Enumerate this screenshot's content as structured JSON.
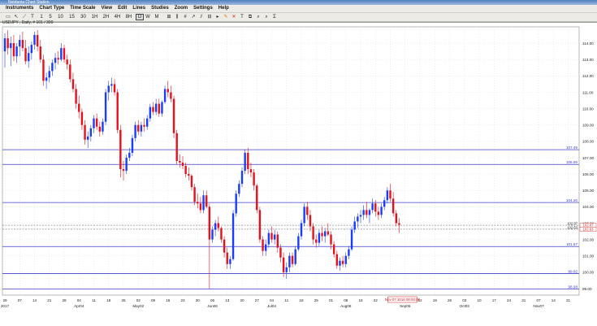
{
  "window": {
    "title": "Netdania Chart Station"
  },
  "menu": [
    "Instruments",
    "Chart Type",
    "Time Scale",
    "View",
    "Edit",
    "Lines",
    "Studies",
    "Zoom",
    "Settings",
    "Help"
  ],
  "toolbar": {
    "timeframes": [
      "T",
      "1",
      "5",
      "10",
      "15",
      "30",
      "1H",
      "2H",
      "4H",
      "8H",
      "D",
      "W",
      "M"
    ],
    "selected": "D"
  },
  "symbol_label": "USDJPY , Daily, # 101 / 300",
  "colors": {
    "up": "#1a3cff",
    "down": "#e8101a",
    "level": "#3f3fd0",
    "grid": "#c8c8c8"
  },
  "chart_data": {
    "type": "candlestick",
    "ylim": [
      98.6,
      115.0
    ],
    "x_tick_labels": [
      "29",
      "07",
      "14",
      "21",
      "28",
      "04",
      "11",
      "18",
      "25",
      "02",
      "09",
      "16",
      "23",
      "30",
      "06",
      "13",
      "20",
      "27",
      "04",
      "11",
      "18",
      "25",
      "01",
      "08",
      "15",
      "22",
      "29",
      "05",
      "12",
      "19",
      "26",
      "03",
      "10",
      "17",
      "24",
      "31",
      "07",
      "14",
      "21"
    ],
    "x_tick_index": [
      0,
      5,
      10,
      15,
      20,
      25,
      30,
      35,
      40,
      45,
      50,
      55,
      60,
      65,
      70,
      75,
      80,
      85,
      90,
      95,
      100,
      105,
      110,
      115,
      120,
      125,
      130,
      135,
      140,
      145,
      150,
      155,
      160,
      165,
      170,
      175,
      180,
      185,
      190
    ],
    "x_sub_labels": [
      {
        "text": "2017",
        "at": 0
      },
      {
        "text": "Apr04",
        "at": 25
      },
      {
        "text": "May02",
        "at": 45
      },
      {
        "text": "Jun06",
        "at": 70
      },
      {
        "text": "Jul04",
        "at": 90
      },
      {
        "text": "Aug08",
        "at": 115
      },
      {
        "text": "Sep05",
        "at": 135
      },
      {
        "text": "Oct03",
        "at": 155
      },
      {
        "text": "Nov07",
        "at": 180
      }
    ],
    "y_ticks": [
      99.0,
      100.0,
      101.0,
      102.0,
      103.0,
      104.0,
      105.0,
      106.0,
      107.0,
      108.0,
      109.0,
      110.0,
      111.0,
      112.0,
      113.0,
      114.0
    ],
    "levels": [
      107.49,
      106.59,
      104.26,
      101.57,
      99.92,
      98.98
    ],
    "current_lines": [
      102.87,
      102.63
    ],
    "current_label": "Nov 07 2016 00:00:00",
    "candles": [
      [
        113.5,
        114.6,
        112.5,
        114.3
      ],
      [
        114.3,
        114.8,
        113.3,
        113.7
      ],
      [
        113.7,
        114.4,
        112.6,
        114.0
      ],
      [
        114.0,
        114.5,
        112.9,
        113.2
      ],
      [
        113.2,
        114.0,
        112.8,
        113.8
      ],
      [
        113.8,
        114.5,
        113.2,
        114.2
      ],
      [
        114.2,
        114.7,
        113.5,
        113.7
      ],
      [
        113.7,
        114.2,
        112.7,
        112.9
      ],
      [
        112.9,
        113.8,
        112.5,
        113.4
      ],
      [
        113.4,
        114.1,
        113.0,
        113.9
      ],
      [
        113.9,
        114.7,
        113.6,
        114.5
      ],
      [
        114.5,
        114.8,
        113.5,
        113.8
      ],
      [
        113.8,
        114.2,
        112.8,
        113.0
      ],
      [
        113.0,
        113.3,
        111.4,
        111.7
      ],
      [
        111.7,
        112.2,
        111.2,
        111.9
      ],
      [
        111.9,
        112.6,
        111.6,
        112.3
      ],
      [
        112.3,
        113.0,
        112.0,
        112.8
      ],
      [
        112.8,
        113.4,
        112.4,
        113.1
      ],
      [
        113.1,
        113.5,
        112.7,
        113.0
      ],
      [
        113.0,
        114.0,
        112.9,
        113.7
      ],
      [
        113.7,
        113.9,
        112.8,
        113.0
      ],
      [
        113.0,
        113.3,
        112.4,
        112.7
      ],
      [
        112.7,
        113.0,
        111.6,
        111.8
      ],
      [
        111.8,
        112.2,
        111.0,
        111.2
      ],
      [
        111.2,
        111.5,
        110.0,
        110.3
      ],
      [
        110.3,
        110.8,
        109.4,
        109.8
      ],
      [
        109.8,
        110.0,
        108.7,
        109.0
      ],
      [
        109.0,
        109.3,
        107.8,
        108.1
      ],
      [
        108.1,
        108.6,
        107.6,
        108.3
      ],
      [
        108.3,
        109.0,
        108.0,
        108.8
      ],
      [
        108.8,
        109.6,
        108.5,
        109.4
      ],
      [
        109.4,
        109.7,
        108.7,
        108.9
      ],
      [
        108.9,
        109.2,
        108.3,
        108.6
      ],
      [
        108.6,
        109.4,
        108.4,
        109.2
      ],
      [
        109.2,
        111.2,
        109.0,
        111.0
      ],
      [
        111.0,
        111.7,
        110.5,
        111.4
      ],
      [
        111.4,
        111.9,
        111.0,
        111.5
      ],
      [
        111.5,
        111.8,
        110.8,
        111.0
      ],
      [
        111.0,
        111.2,
        108.5,
        108.7
      ],
      [
        108.7,
        109.0,
        105.8,
        106.3
      ],
      [
        106.3,
        106.8,
        105.6,
        106.2
      ],
      [
        106.2,
        107.2,
        106.0,
        107.0
      ],
      [
        107.0,
        107.6,
        106.8,
        107.3
      ],
      [
        107.3,
        108.4,
        107.1,
        108.2
      ],
      [
        108.2,
        109.2,
        108.0,
        109.0
      ],
      [
        109.0,
        109.3,
        108.4,
        108.6
      ],
      [
        108.6,
        109.2,
        108.3,
        109.0
      ],
      [
        109.0,
        109.4,
        108.6,
        108.9
      ],
      [
        108.9,
        109.6,
        108.7,
        109.4
      ],
      [
        109.4,
        110.3,
        109.2,
        110.1
      ],
      [
        110.1,
        110.4,
        109.6,
        109.8
      ],
      [
        109.8,
        110.6,
        109.6,
        110.3
      ],
      [
        110.3,
        110.6,
        109.5,
        109.7
      ],
      [
        109.7,
        110.5,
        109.5,
        110.4
      ],
      [
        110.4,
        111.4,
        110.3,
        111.2
      ],
      [
        111.2,
        111.7,
        110.7,
        111.0
      ],
      [
        111.0,
        111.4,
        110.4,
        110.6
      ],
      [
        110.6,
        110.8,
        108.2,
        108.5
      ],
      [
        108.5,
        108.7,
        106.6,
        106.8
      ],
      [
        106.8,
        107.2,
        106.4,
        106.7
      ],
      [
        106.7,
        107.1,
        106.3,
        106.5
      ],
      [
        106.5,
        106.7,
        105.8,
        106.0
      ],
      [
        106.0,
        106.4,
        105.6,
        105.9
      ],
      [
        105.9,
        106.0,
        105.0,
        105.2
      ],
      [
        105.2,
        105.4,
        104.1,
        104.3
      ],
      [
        104.3,
        104.8,
        103.9,
        104.2
      ],
      [
        104.2,
        104.6,
        103.6,
        103.8
      ],
      [
        103.8,
        105.0,
        103.6,
        104.7
      ],
      [
        104.7,
        105.0,
        103.9,
        104.0
      ],
      [
        104.0,
        104.2,
        99.0,
        102.0
      ],
      [
        102.0,
        102.8,
        101.8,
        102.6
      ],
      [
        102.6,
        103.2,
        102.2,
        103.0
      ],
      [
        103.0,
        103.4,
        102.5,
        102.7
      ],
      [
        102.7,
        102.8,
        101.8,
        102.0
      ],
      [
        102.0,
        102.2,
        100.9,
        101.2
      ],
      [
        101.2,
        101.5,
        100.2,
        100.5
      ],
      [
        100.5,
        101.0,
        100.2,
        100.8
      ],
      [
        100.8,
        103.8,
        100.7,
        103.6
      ],
      [
        103.6,
        105.0,
        103.4,
        104.8
      ],
      [
        104.8,
        105.6,
        104.6,
        105.4
      ],
      [
        105.4,
        106.4,
        105.2,
        106.2
      ],
      [
        106.2,
        107.5,
        106.0,
        107.3
      ],
      [
        107.3,
        107.6,
        106.0,
        106.3
      ],
      [
        106.3,
        106.7,
        105.8,
        106.1
      ],
      [
        106.1,
        106.3,
        105.0,
        105.3
      ],
      [
        105.3,
        105.4,
        103.6,
        103.8
      ],
      [
        103.8,
        104.0,
        101.8,
        102.0
      ],
      [
        102.0,
        102.2,
        101.0,
        101.3
      ],
      [
        101.3,
        102.0,
        101.0,
        101.7
      ],
      [
        101.7,
        102.6,
        101.5,
        102.4
      ],
      [
        102.4,
        102.8,
        101.8,
        102.0
      ],
      [
        102.0,
        102.6,
        101.7,
        102.3
      ],
      [
        102.3,
        102.5,
        101.2,
        101.5
      ],
      [
        101.5,
        101.7,
        100.6,
        100.9
      ],
      [
        100.9,
        101.2,
        99.7,
        100.0
      ],
      [
        100.0,
        100.6,
        99.6,
        100.3
      ],
      [
        100.3,
        101.2,
        100.0,
        101.0
      ],
      [
        101.0,
        101.2,
        100.3,
        100.5
      ],
      [
        100.5,
        101.6,
        100.4,
        101.4
      ],
      [
        101.4,
        102.4,
        101.3,
        102.2
      ],
      [
        102.2,
        103.2,
        102.0,
        103.0
      ],
      [
        103.0,
        104.2,
        102.8,
        104.0
      ],
      [
        104.0,
        104.3,
        103.2,
        103.5
      ],
      [
        103.5,
        103.8,
        102.5,
        102.8
      ],
      [
        102.8,
        103.0,
        101.7,
        102.0
      ],
      [
        102.0,
        102.3,
        101.5,
        101.8
      ],
      [
        101.8,
        102.6,
        101.6,
        102.4
      ],
      [
        102.4,
        102.8,
        101.9,
        102.2
      ],
      [
        102.2,
        102.7,
        101.8,
        102.5
      ],
      [
        102.5,
        103.0,
        102.2,
        102.3
      ],
      [
        102.3,
        102.5,
        101.4,
        101.7
      ],
      [
        101.7,
        101.9,
        100.9,
        101.1
      ],
      [
        101.1,
        101.3,
        100.2,
        100.4
      ],
      [
        100.4,
        100.9,
        100.1,
        100.7
      ],
      [
        100.7,
        101.0,
        100.3,
        100.5
      ],
      [
        100.5,
        101.2,
        100.3,
        101.0
      ],
      [
        101.0,
        101.6,
        100.8,
        101.4
      ],
      [
        101.4,
        102.8,
        101.3,
        102.6
      ],
      [
        102.6,
        103.4,
        102.4,
        103.1
      ],
      [
        103.1,
        103.6,
        102.7,
        103.4
      ],
      [
        103.4,
        103.8,
        103.0,
        103.5
      ],
      [
        103.5,
        104.1,
        103.2,
        103.8
      ],
      [
        103.8,
        104.3,
        103.3,
        103.5
      ],
      [
        103.5,
        103.9,
        103.0,
        103.8
      ],
      [
        103.8,
        104.5,
        103.6,
        104.2
      ],
      [
        104.2,
        104.4,
        103.4,
        103.7
      ],
      [
        103.7,
        104.0,
        103.2,
        103.5
      ],
      [
        103.5,
        104.2,
        103.3,
        104.0
      ],
      [
        104.0,
        104.6,
        103.8,
        104.4
      ],
      [
        104.4,
        105.2,
        104.2,
        105.0
      ],
      [
        105.0,
        105.4,
        104.3,
        104.5
      ],
      [
        104.5,
        104.9,
        103.4,
        103.6
      ],
      [
        103.6,
        103.8,
        102.8,
        103.0
      ],
      [
        103.0,
        103.3,
        102.4,
        102.9
      ]
    ]
  }
}
